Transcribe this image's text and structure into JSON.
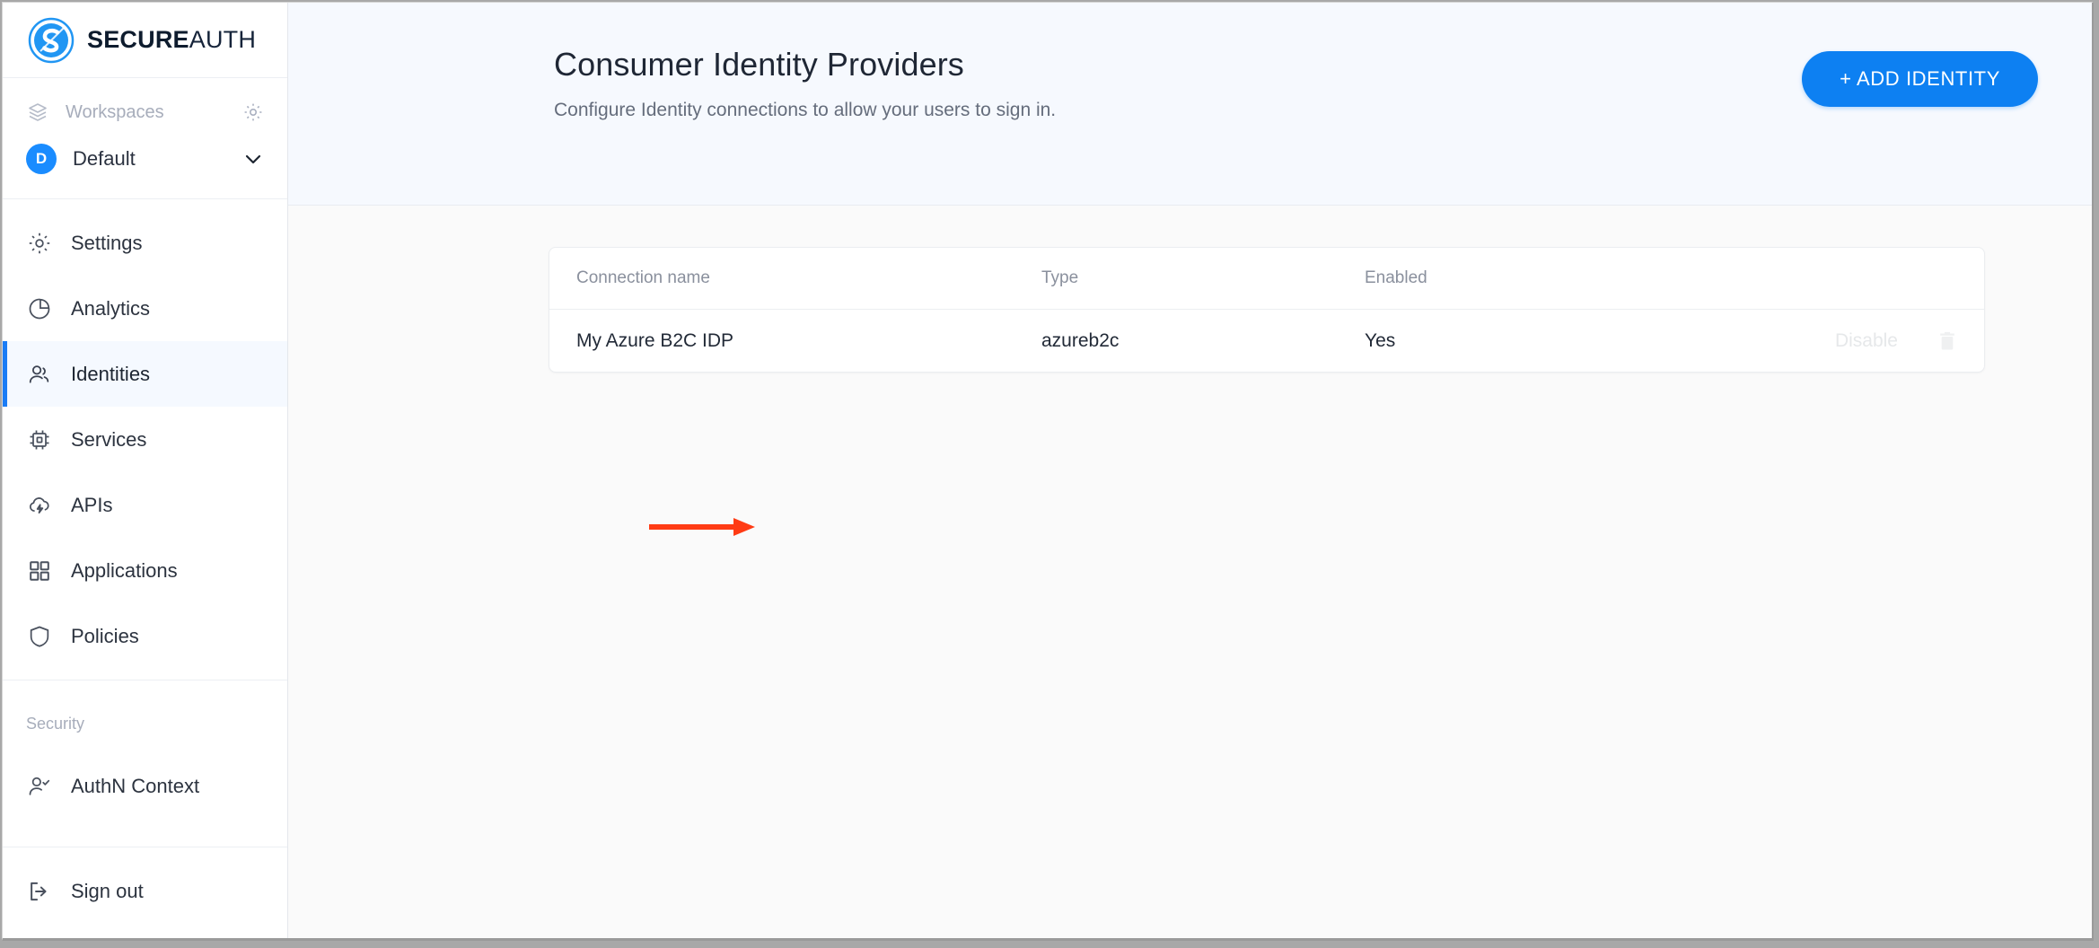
{
  "brand": {
    "name_bold": "SECURE",
    "name_light": "AUTH",
    "logo_icon": "secureauth-s-logo-icon",
    "logo_color": "#1a8cff"
  },
  "sidebar": {
    "workspaces": {
      "label": "Workspaces",
      "layers_icon": "layers-icon",
      "gear_icon": "gear-icon"
    },
    "current_workspace": {
      "avatar_initial": "D",
      "name": "Default",
      "chevron_icon": "chevron-down-icon",
      "avatar_color": "#1a8cff"
    },
    "nav_items": [
      {
        "label": "Settings",
        "icon": "gear-icon",
        "active": false
      },
      {
        "label": "Analytics",
        "icon": "pie-chart-icon",
        "active": false
      },
      {
        "label": "Identities",
        "icon": "users-icon",
        "active": true
      },
      {
        "label": "Services",
        "icon": "chip-icon",
        "active": false
      },
      {
        "label": "APIs",
        "icon": "cloud-bolt-icon",
        "active": false
      },
      {
        "label": "Applications",
        "icon": "grid-squares-icon",
        "active": false
      },
      {
        "label": "Policies",
        "icon": "shield-icon",
        "active": false
      }
    ],
    "security_section": {
      "title": "Security",
      "items": [
        {
          "label": "AuthN Context",
          "icon": "user-check-icon"
        }
      ]
    },
    "signout": {
      "label": "Sign out",
      "icon": "sign-out-icon"
    },
    "active_accent_color": "#1a7cf5",
    "active_bg_color": "#f5f9ff"
  },
  "header": {
    "title": "Consumer Identity Providers",
    "subtitle": "Configure Identity connections to allow your users to sign in.",
    "add_button_label": "+ ADD IDENTITY",
    "add_button_color": "#0d80f2",
    "background_color": "#f6f9fe"
  },
  "table": {
    "columns": [
      "Connection name",
      "Type",
      "Enabled"
    ],
    "rows": [
      {
        "connection_name": "My Azure B2C IDP",
        "type": "azureb2c",
        "enabled": "Yes",
        "disable_label": "Disable",
        "delete_icon": "trash-icon"
      }
    ]
  },
  "annotation": {
    "arrow_icon": "right-arrow-annotation",
    "arrow_color": "#ff3b14"
  }
}
